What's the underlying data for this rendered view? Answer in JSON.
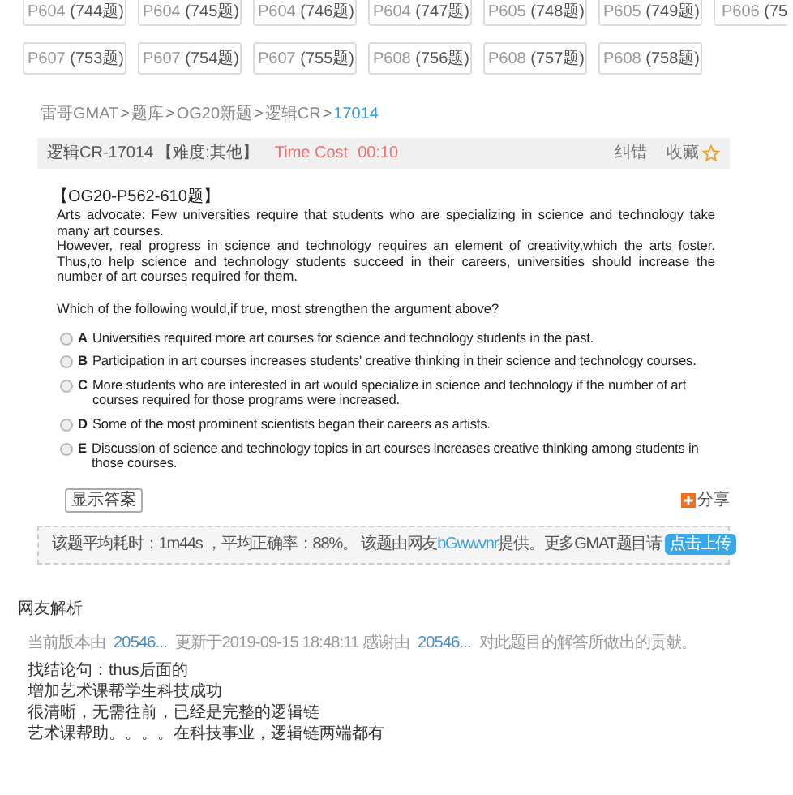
{
  "page_buttons": [
    {
      "page": "P604",
      "count": "(744题)"
    },
    {
      "page": "P604",
      "count": "(745题)"
    },
    {
      "page": "P604",
      "count": "(746题)"
    },
    {
      "page": "P604",
      "count": "(747题)"
    },
    {
      "page": "P605",
      "count": "(748题)"
    },
    {
      "page": "P605",
      "count": "(749题)"
    },
    {
      "page": "P606",
      "count": "(75"
    },
    {
      "page": "P607",
      "count": "(753题)"
    },
    {
      "page": "P607",
      "count": "(754题)"
    },
    {
      "page": "P607",
      "count": "(755题)"
    },
    {
      "page": "P608",
      "count": "(756题)"
    },
    {
      "page": "P608",
      "count": "(757题)"
    },
    {
      "page": "P608",
      "count": "(758题)"
    }
  ],
  "breadcrumb": [
    {
      "label": "雷哥GMAT",
      "current": false
    },
    {
      "label": "题库",
      "current": false
    },
    {
      "label": "OG20新题",
      "current": false
    },
    {
      "label": "逻辑CR",
      "current": false
    },
    {
      "label": "17014",
      "current": true
    }
  ],
  "breadcrumb_separator": ">",
  "question_header": {
    "id": "逻辑CR-17014",
    "difficulty": "【难度:其他】",
    "timer_label": "Time Cost",
    "timer": "00:10",
    "report": "纠错",
    "favorite": "收藏"
  },
  "question": {
    "source": "【OG20-P562-610题】",
    "paragraphs": [
      "Arts advocate: Few universities require that students who are specializing in science and technology take many art courses.",
      "However, real progress in science and technology requires an element of creativity,which the arts foster. Thus,to help science and technology students succeed in their careers, universities should increase the number of art courses required for them."
    ],
    "prompt": "Which of the following would,if true, most strengthen the argument above?",
    "options": [
      {
        "letter": "A",
        "text": "Universities required more art courses for science and technology students in the past.",
        "selected": false
      },
      {
        "letter": "B",
        "text": "Participation in art courses increases students' creative thinking in their science and technology courses.",
        "selected": false
      },
      {
        "letter": "C",
        "text": "More students who are interested in art would specialize in science and technology if the number of art courses required for those programs were increased.",
        "selected": false
      },
      {
        "letter": "D",
        "text": "Some of the most prominent scientists began their careers as artists.",
        "selected": false
      },
      {
        "letter": "E",
        "text": "Discussion of science and technology topics in art courses increases creative thinking among students in those courses.",
        "selected": false
      }
    ]
  },
  "show_answer_button": "显示答案",
  "share": "分享",
  "stats": {
    "text_before": "该题平均耗时：1m44s ，平均正确率：88%。 该题由网友",
    "user": "bGwwvnr",
    "text_after": "提供。更多GMAT题目请",
    "upload_button": "点击上传"
  },
  "analysis": {
    "title": "网友解析",
    "meta": [
      {
        "kind": "text",
        "text": "当前版本由"
      },
      {
        "kind": "link",
        "text": "20546..."
      },
      {
        "kind": "text",
        "text": "更新于2019-09-15 18:48:11 感谢由"
      },
      {
        "kind": "link",
        "text": "20546..."
      },
      {
        "kind": "text",
        "text": "对此题目的解答所做出的贡献。"
      }
    ],
    "lines": [
      "找结论句：thus后面的",
      "增加艺术课帮学生科技成功",
      "很清晰，无需往前，已经是完整的逻辑链",
      "艺术课帮助。。。。在科技事业，逻辑链两端都有"
    ]
  }
}
